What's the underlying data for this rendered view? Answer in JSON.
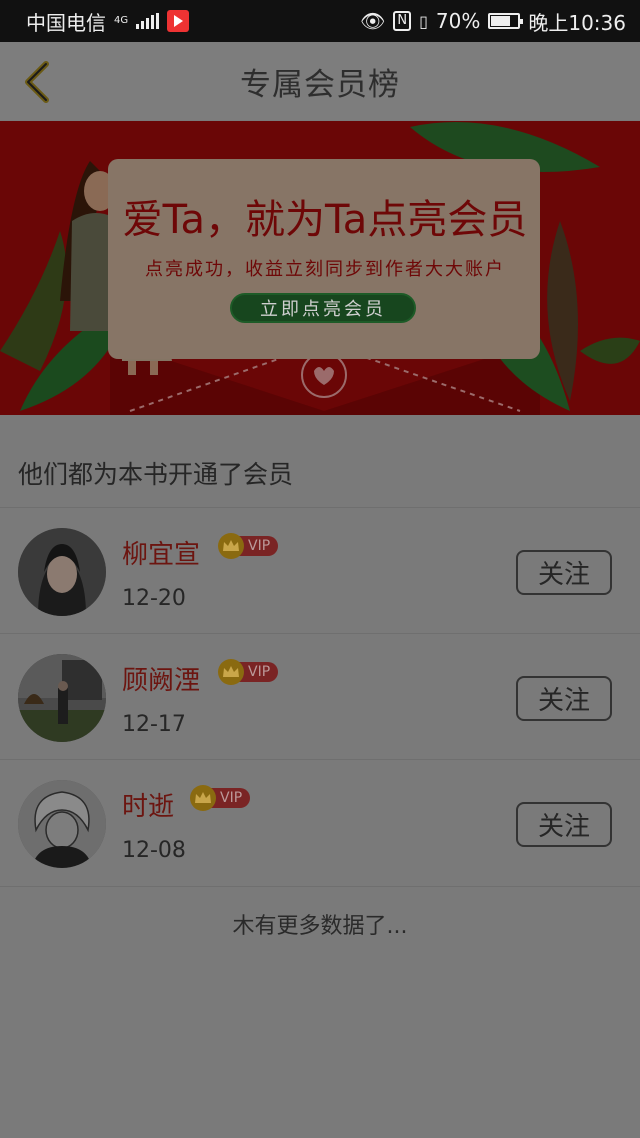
{
  "status_bar": {
    "carrier": "中国电信",
    "network": "4G",
    "battery": "70%",
    "battery_level": 0.7,
    "time": "晚上10:36"
  },
  "header": {
    "title": "专属会员榜",
    "back_icon": "chevron-left-icon"
  },
  "banner": {
    "headline": "爱Ta，就为Ta点亮会员",
    "subtitle": "点亮成功，收益立刻同步到作者大大账户",
    "button_label": "立即点亮会员"
  },
  "section": {
    "title": "他们都为本书开通了会员"
  },
  "members": [
    {
      "name": "柳宜宣",
      "badge": "VIP",
      "date": "12-20",
      "follow_label": "关注"
    },
    {
      "name": "顾阙湮",
      "badge": "VIP",
      "date": "12-17",
      "follow_label": "关注"
    },
    {
      "name": "时逝",
      "badge": "VIP",
      "date": "12-08",
      "follow_label": "关注"
    }
  ],
  "footer": {
    "no_more": "木有更多数据了..."
  },
  "colors": {
    "overlay_bg": "#7a7a7a",
    "banner_red": "#6a0606",
    "name_red": "#6c1510",
    "vip_gold": "#8a6a10"
  }
}
